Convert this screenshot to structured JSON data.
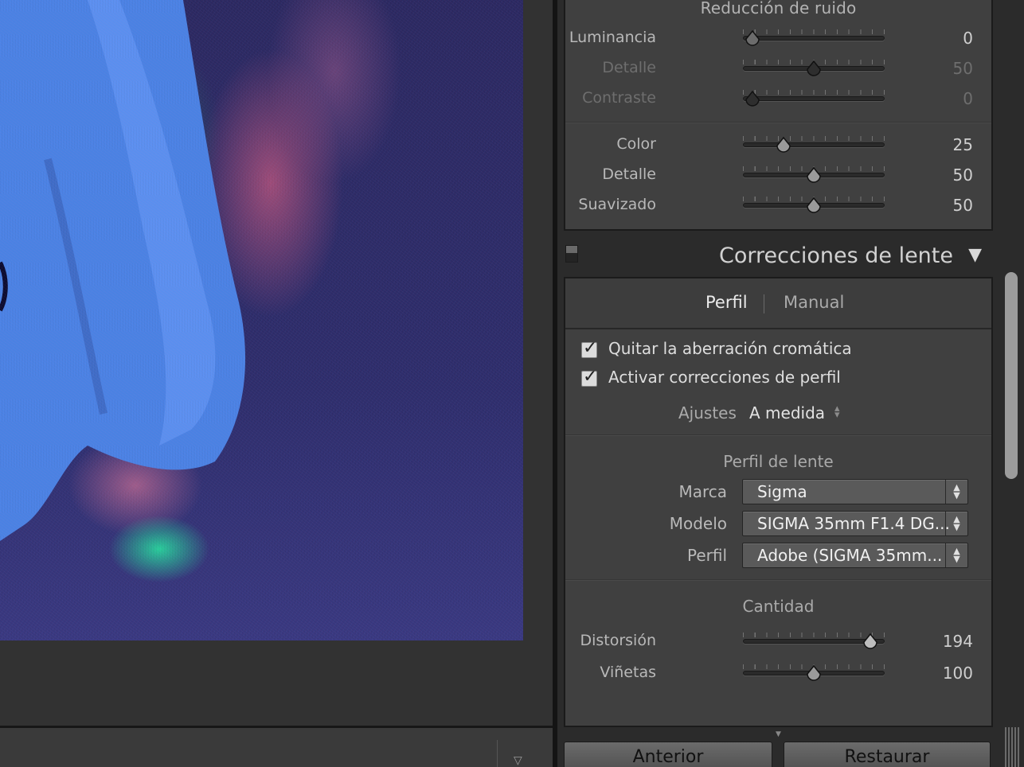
{
  "noise_reduction": {
    "title": "Reducción de ruido",
    "luminance_sliders": [
      {
        "label": "Luminancia",
        "value": "0",
        "pos": 0.07,
        "enabled": true
      },
      {
        "label": "Detalle",
        "value": "50",
        "pos": 0.5,
        "enabled": false
      },
      {
        "label": "Contraste",
        "value": "0",
        "pos": 0.07,
        "enabled": false
      }
    ],
    "color_sliders": [
      {
        "label": "Color",
        "value": "25",
        "pos": 0.28,
        "enabled": true
      },
      {
        "label": "Detalle",
        "value": "50",
        "pos": 0.5,
        "enabled": true
      },
      {
        "label": "Suavizado",
        "value": "50",
        "pos": 0.5,
        "enabled": true
      }
    ]
  },
  "lens": {
    "title": "Correcciones de lente",
    "tabs": {
      "active": "Perfil",
      "inactive": "Manual"
    },
    "checks": [
      {
        "label": "Quitar la aberración cromática",
        "checked": true
      },
      {
        "label": "Activar correcciones de perfil",
        "checked": true
      }
    ],
    "setup_label": "Ajustes",
    "setup_value": "A medida",
    "profile_title": "Perfil de lente",
    "make_label": "Marca",
    "make_value": "Sigma",
    "model_label": "Modelo",
    "model_value": "SIGMA 35mm F1.4 DG...",
    "profile_label": "Perfil",
    "profile_value": "Adobe (SIGMA 35mm...",
    "amount_title": "Cantidad",
    "amount_sliders": [
      {
        "label": "Distorsión",
        "value": "194",
        "pos": 0.9
      },
      {
        "label": "Viñetas",
        "value": "100",
        "pos": 0.5
      }
    ]
  },
  "buttons": {
    "previous": "Anterior",
    "reset": "Restaurar"
  },
  "colors": {
    "panel_bg": "#404040",
    "accent_text": "#d2d2d2"
  }
}
